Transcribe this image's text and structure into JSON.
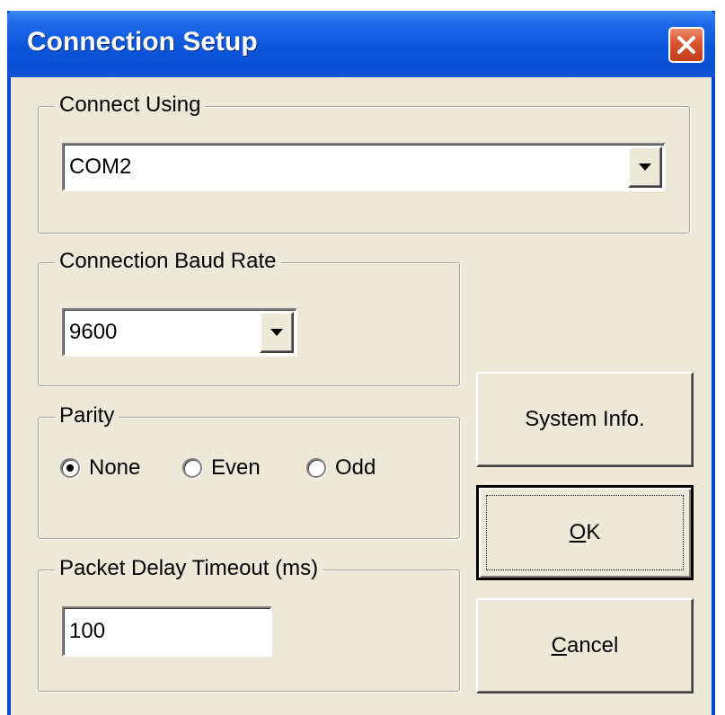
{
  "window": {
    "title": "Connection Setup"
  },
  "connect_using": {
    "label": "Connect Using",
    "value": "COM2"
  },
  "baud_rate": {
    "label": "Connection Baud Rate",
    "value": "9600"
  },
  "parity": {
    "label": "Parity",
    "options": [
      {
        "label": "None",
        "checked": true
      },
      {
        "label": "Even",
        "checked": false
      },
      {
        "label": "Odd",
        "checked": false
      }
    ]
  },
  "packet_delay": {
    "label": "Packet Delay Timeout (ms)",
    "value": "100"
  },
  "buttons": {
    "system_info": "System Info.",
    "ok_mnemonic": "O",
    "ok_rest": "K",
    "cancel_mnemonic": "C",
    "cancel_rest": "ancel"
  },
  "icons": {
    "close": "close-icon",
    "dropdown": "chevron-down-icon"
  },
  "colors": {
    "titlebar": "#0A4FD3",
    "dialog_bg": "#ECE9D8",
    "close_button": "#D9532F"
  }
}
